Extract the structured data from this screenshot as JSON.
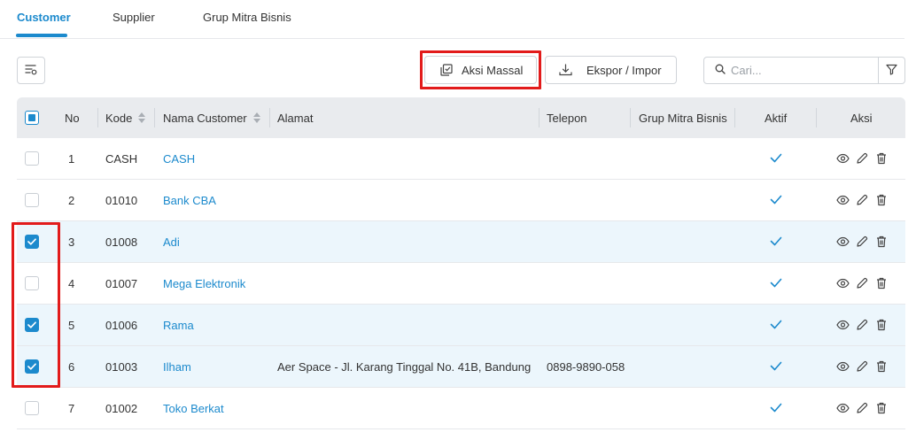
{
  "tabs": [
    {
      "label": "Customer",
      "active": true
    },
    {
      "label": "Supplier",
      "active": false
    },
    {
      "label": "Grup Mitra Bisnis",
      "active": false
    }
  ],
  "toolbar": {
    "bulk_action_label": "Aksi Massal",
    "export_import_label": "Ekspor / Impor",
    "search_placeholder": "Cari...",
    "search_value": ""
  },
  "colors": {
    "accent": "#1c8acd",
    "highlight": "#e21b1b",
    "selected_row": "#ecf6fc",
    "header_bg": "#e9ebee"
  },
  "table": {
    "headers": {
      "no": "No",
      "kode": "Kode",
      "nama": "Nama Customer",
      "alamat": "Alamat",
      "telepon": "Telepon",
      "grup": "Grup Mitra Bisnis",
      "aktif": "Aktif",
      "aksi": "Aksi"
    },
    "select_all_state": "partial",
    "rows": [
      {
        "checked": false,
        "no": "1",
        "kode": "CASH",
        "nama": "CASH",
        "alamat": "",
        "telepon": "",
        "grup": "",
        "aktif": true
      },
      {
        "checked": false,
        "no": "2",
        "kode": "01010",
        "nama": "Bank CBA",
        "alamat": "",
        "telepon": "",
        "grup": "",
        "aktif": true
      },
      {
        "checked": true,
        "no": "3",
        "kode": "01008",
        "nama": "Adi",
        "alamat": "",
        "telepon": "",
        "grup": "",
        "aktif": true
      },
      {
        "checked": false,
        "no": "4",
        "kode": "01007",
        "nama": "Mega Elektronik",
        "alamat": "",
        "telepon": "",
        "grup": "",
        "aktif": true
      },
      {
        "checked": true,
        "no": "5",
        "kode": "01006",
        "nama": "Rama",
        "alamat": "",
        "telepon": "",
        "grup": "",
        "aktif": true
      },
      {
        "checked": true,
        "no": "6",
        "kode": "01003",
        "nama": "Ilham",
        "alamat": "Aer Space - Jl. Karang Tinggal No. 41B, Bandung",
        "telepon": "0898-9890-058",
        "grup": "",
        "aktif": true
      },
      {
        "checked": false,
        "no": "7",
        "kode": "01002",
        "nama": "Toko Berkat",
        "alamat": "",
        "telepon": "",
        "grup": "",
        "aktif": true
      }
    ],
    "row_action_icons": [
      "eye-icon",
      "pencil-icon",
      "trash-icon"
    ]
  }
}
